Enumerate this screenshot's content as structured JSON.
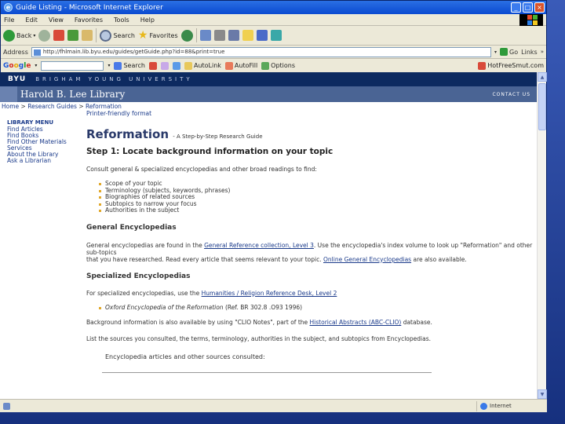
{
  "window": {
    "title": "Guide Listing - Microsoft Internet Explorer"
  },
  "menu": [
    "File",
    "Edit",
    "View",
    "Favorites",
    "Tools",
    "Help"
  ],
  "toolbar": {
    "back": "Back",
    "search": "Search",
    "favorites": "Favorites"
  },
  "address": {
    "label": "Address",
    "url": "http://fhlmain.lib.byu.edu/guides/getGuide.php?id=88&print=true",
    "go": "Go",
    "links": "Links"
  },
  "google_toolbar": {
    "logo_g": "G",
    "logo_o1": "o",
    "logo_o2": "o",
    "logo_g2": "g",
    "logo_l": "l",
    "logo_e": "e",
    "search": "Search",
    "items": [
      "AutoLink",
      "AutoFill",
      "Options"
    ],
    "right": "HotFreeSmut.com"
  },
  "page": {
    "byu": "BYU",
    "university": "BRIGHAM YOUNG UNIVERSITY",
    "library": "Harold B. Lee Library",
    "contact": "CONTACT US",
    "breadcrumb": {
      "home": "Home",
      "research_guides": "Research Guides",
      "current": "Reformation"
    },
    "printer_link": "Printer-friendly format",
    "sidenav": {
      "heading": "LIBRARY MENU",
      "items": [
        "Find Articles",
        "Find Books",
        "Find Other Materials",
        "Services",
        "About the Library",
        "Ask a Librarian"
      ]
    },
    "title": "Reformation",
    "subtitle": "- A Step-by-Step Research Guide",
    "step1": "Step 1: Locate background information on your topic",
    "intro": "Consult general & specialized encyclopedias and other broad readings to find:",
    "bullets": [
      "Scope of your topic",
      "Terminology (subjects, keywords, phrases)",
      "Biographies of related sources",
      "Subtopics to narrow your focus",
      "Authorities in the subject"
    ],
    "general_heading": "General Encyclopedias",
    "general_text_1": "General encyclopedias are found in the",
    "general_link_1": "General Reference collection, Level 3",
    "general_text_2": ". Use the encyclopedia's index volume to look up \"Reformation\" and other sub-topics",
    "general_text_3": "that you have researched. Read every article that seems relevant to your topic.",
    "general_link_2": "Online General Encyclopedias",
    "general_text_4": "are also available.",
    "specialized_heading": "Specialized Encyclopedias",
    "specialized_text": "For specialized encyclopedias, use the",
    "specialized_link": "Humanities / Religion Reference Desk, Level 2",
    "specialized_bullet": "Oxford Encyclopedia of the Reformation",
    "specialized_bullet_ref": "(Ref. BR 302.8 .O93 1996)",
    "bg_text_1": "Background information is also available by using \"CLIO Notes\", part of the",
    "bg_link": "Historical Abstracts (ABC-CLIO)",
    "bg_text_2": "database.",
    "list_text": "List the sources you consulted, the terms, terminology, authorities in the subject, and subtopics from Encyclopedias.",
    "consulted": "Encyclopedia articles and other sources consulted:"
  },
  "status": {
    "left": "",
    "zone": "Internet"
  }
}
